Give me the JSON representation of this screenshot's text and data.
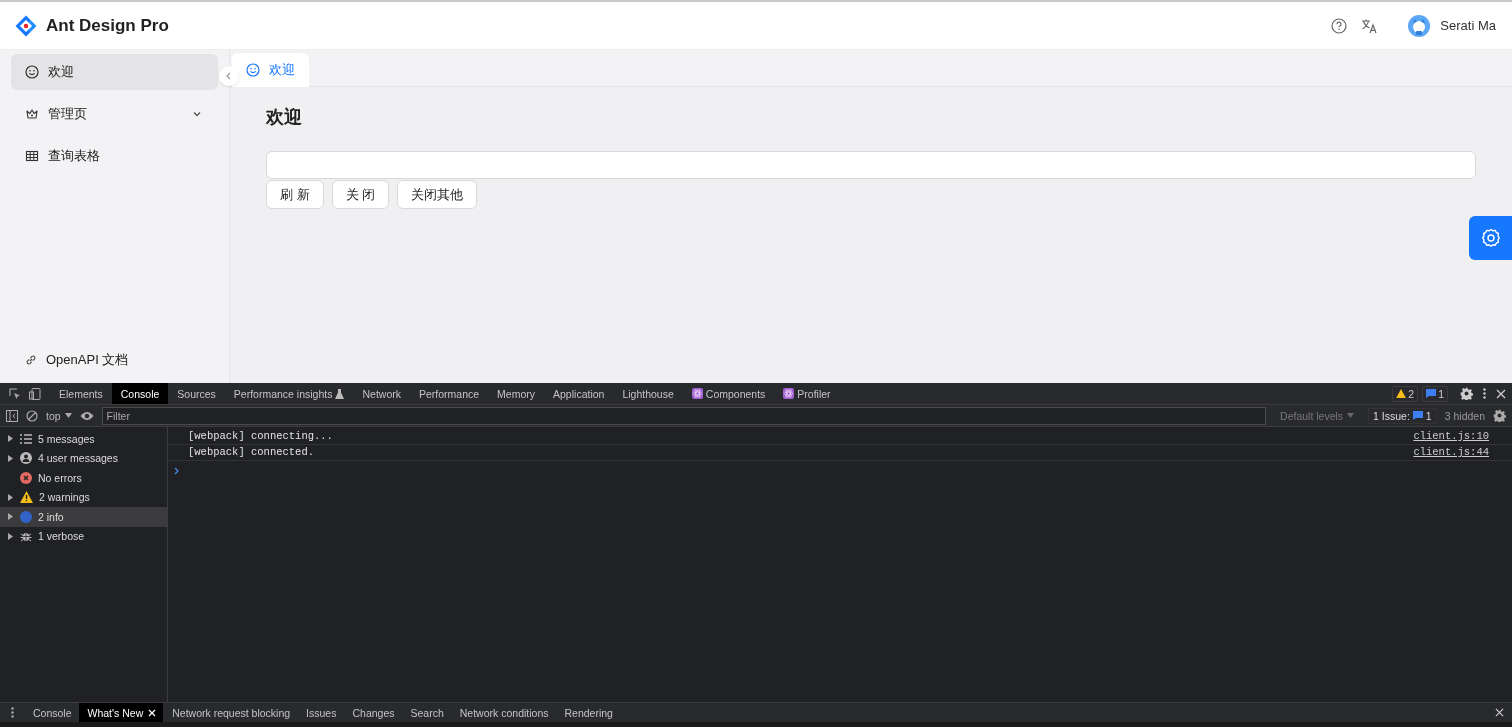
{
  "header": {
    "title": "Ant Design Pro",
    "user": "Serati Ma"
  },
  "sidebar": {
    "items": [
      {
        "label": "欢迎",
        "kind": "link",
        "selected": true
      },
      {
        "label": "管理页",
        "kind": "submenu",
        "selected": false,
        "expanded": false
      },
      {
        "label": "查询表格",
        "kind": "link",
        "selected": false
      }
    ],
    "footer_link": "OpenAPI 文档"
  },
  "page_tabs": [
    {
      "label": "欢迎",
      "selected": true
    }
  ],
  "content": {
    "title": "欢迎",
    "buttons": [
      "刷 新",
      "关 闭",
      "关闭其他"
    ]
  },
  "devtools": {
    "tabs": [
      {
        "label": "Elements",
        "kind": "plain",
        "selected": false
      },
      {
        "label": "Console",
        "kind": "plain",
        "selected": true
      },
      {
        "label": "Sources",
        "kind": "plain",
        "selected": false
      },
      {
        "label": "Performance insights",
        "kind": "experiment",
        "selected": false
      },
      {
        "label": "Network",
        "kind": "plain",
        "selected": false
      },
      {
        "label": "Performance",
        "kind": "plain",
        "selected": false
      },
      {
        "label": "Memory",
        "kind": "plain",
        "selected": false
      },
      {
        "label": "Application",
        "kind": "plain",
        "selected": false
      },
      {
        "label": "Lighthouse",
        "kind": "plain",
        "selected": false
      },
      {
        "label": "Components",
        "kind": "react",
        "selected": false
      },
      {
        "label": "Profiler",
        "kind": "react",
        "selected": false
      }
    ],
    "warning_count": "2",
    "message_count": "1",
    "context": "top",
    "filter_placeholder": "Filter",
    "levels": "Default levels",
    "issues_label": "1 Issue:",
    "issues_count": "1",
    "hidden": "3 hidden",
    "sidebar": [
      {
        "label": "5 messages",
        "expandable": true,
        "selected": false
      },
      {
        "label": "4 user messages",
        "expandable": true,
        "selected": false
      },
      {
        "label": "No errors",
        "expandable": false,
        "selected": false
      },
      {
        "label": "2 warnings",
        "expandable": true,
        "selected": false
      },
      {
        "label": "2 info",
        "expandable": true,
        "selected": true
      },
      {
        "label": "1 verbose",
        "expandable": true,
        "selected": false
      }
    ],
    "messages": [
      {
        "text": "[webpack] connecting...",
        "source": "client.js:10"
      },
      {
        "text": "[webpack] connected.",
        "source": "client.js:44"
      }
    ],
    "drawer_tabs": [
      {
        "label": "Console",
        "selected": false
      },
      {
        "label": "What's New",
        "selected": true
      },
      {
        "label": "Network request blocking",
        "selected": false
      },
      {
        "label": "Issues",
        "selected": false
      },
      {
        "label": "Changes",
        "selected": false
      },
      {
        "label": "Search",
        "selected": false
      },
      {
        "label": "Network conditions",
        "selected": false
      },
      {
        "label": "Rendering",
        "selected": false
      }
    ]
  }
}
